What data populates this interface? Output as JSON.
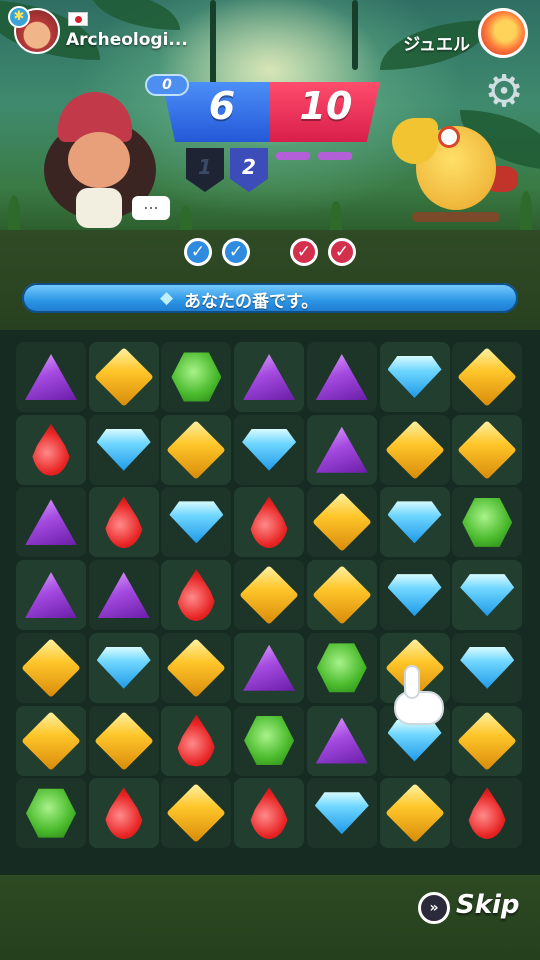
{
  "player": {
    "name": "Archeologi...",
    "flag": "japan-flag-icon"
  },
  "opponent": {
    "name": "ジュエル"
  },
  "scoreboard": {
    "moves_left": "0",
    "player_score": "6",
    "opponent_score": "10"
  },
  "rounds": [
    {
      "label": "1",
      "state": "lost"
    },
    {
      "label": "2",
      "state": "current"
    }
  ],
  "round_checks": {
    "player": [
      "check",
      "check"
    ],
    "opponent": [
      "check",
      "check"
    ]
  },
  "colors": {
    "player": "#2f8be0",
    "opponent": "#d2304d",
    "turn_bar": "#2a94e4"
  },
  "turn_banner": {
    "icon": "diamond-icon",
    "text": "あなたの番です。"
  },
  "chat": {
    "icon": "ellipsis-icon",
    "text": "..."
  },
  "board": {
    "rows": [
      [
        "purple",
        "yellow",
        "green",
        "purple",
        "purple",
        "blue",
        "yellow"
      ],
      [
        "red",
        "blue",
        "yellow",
        "blue",
        "purple",
        "yellow",
        "yellow"
      ],
      [
        "purple",
        "red",
        "blue",
        "red",
        "yellow",
        "blue",
        "green"
      ],
      [
        "purple",
        "purple",
        "red",
        "yellow",
        "yellow",
        "blue",
        "blue"
      ],
      [
        "yellow",
        "blue",
        "yellow",
        "purple",
        "green",
        "yellow",
        "blue"
      ],
      [
        "yellow",
        "yellow",
        "red",
        "green",
        "purple",
        "blue",
        "yellow"
      ],
      [
        "green",
        "red",
        "yellow",
        "red",
        "blue",
        "yellow",
        "red"
      ]
    ],
    "hint": {
      "row": 5,
      "col": 5,
      "icon": "hand-pointer-icon"
    }
  },
  "skip": {
    "label": "Skip",
    "icon": "fast-forward-icon"
  },
  "settings": {
    "icon": "gear-icon"
  }
}
